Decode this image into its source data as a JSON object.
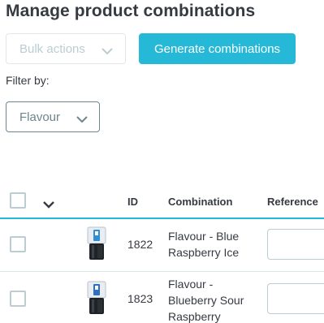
{
  "page": {
    "title": "Manage product combinations"
  },
  "toolbar": {
    "bulk_actions_label": "Bulk actions",
    "generate_label": "Generate combinations"
  },
  "filter": {
    "label": "Filter by:",
    "flavour_label": "Flavour"
  },
  "table": {
    "columns": [
      "ID",
      "Combination",
      "Reference"
    ],
    "rows": [
      {
        "id": "1822",
        "combination": "Flavour - Blue Raspberry Ice",
        "reference": ""
      },
      {
        "id": "1823",
        "combination": "Flavour - Blueberry Sour Raspberry",
        "reference": ""
      }
    ]
  },
  "colors": {
    "accent": "#25b9d7",
    "text": "#363a41",
    "muted": "#bbcdd2",
    "border_dark": "#6c868e"
  },
  "icons": {
    "dropdown": "chevron-down-icon",
    "product": "product-thumbnail"
  }
}
